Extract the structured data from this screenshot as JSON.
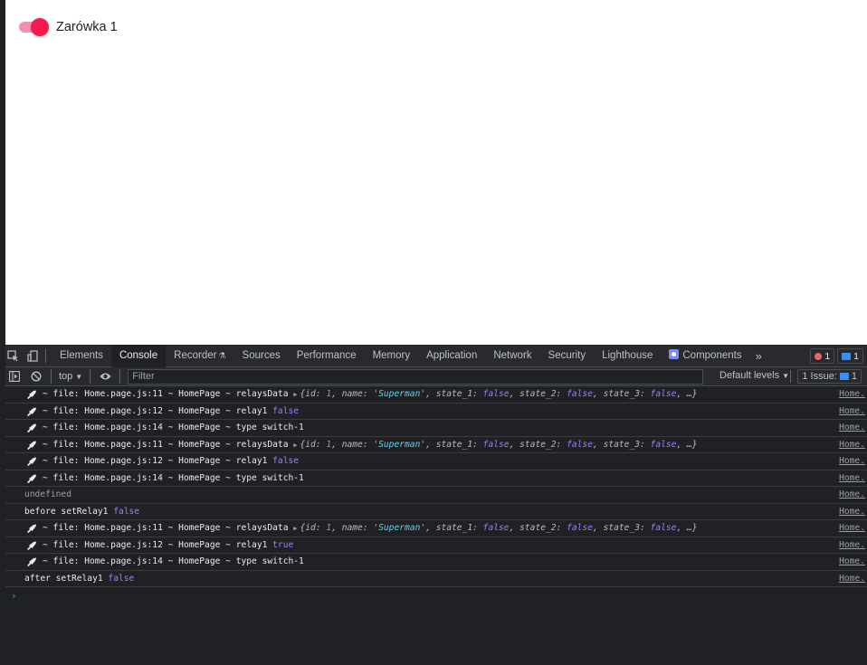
{
  "page": {
    "toggle_label": "Zarówka 1",
    "toggle_on": true
  },
  "devtools": {
    "tabs": [
      {
        "label": "Elements"
      },
      {
        "label": "Console",
        "active": true
      },
      {
        "label": "Recorder",
        "icon": "flask-icon"
      },
      {
        "label": "Sources"
      },
      {
        "label": "Performance"
      },
      {
        "label": "Memory"
      },
      {
        "label": "Application"
      },
      {
        "label": "Network"
      },
      {
        "label": "Security"
      },
      {
        "label": "Lighthouse"
      },
      {
        "label": "Components",
        "icon": "react-components-icon"
      }
    ],
    "more_tabs": "»",
    "error_count": "1",
    "message_count": "1",
    "toolbar": {
      "context": "top",
      "filter_placeholder": "Filter",
      "levels": "Default levels",
      "issues_label": "1 Issue:",
      "issues_count": "1"
    },
    "logs": [
      {
        "rocket": true,
        "prefix": "~ file: Home.page.js:11 ~ HomePage ~ relaysData",
        "object": true,
        "src": "Home."
      },
      {
        "rocket": true,
        "prefix": "~ file: Home.page.js:12 ~ HomePage ~ relay1",
        "value": "false",
        "src": "Home."
      },
      {
        "rocket": true,
        "prefix": "~ file: Home.page.js:14 ~ HomePage ~ type switch-1",
        "src": "Home."
      },
      {
        "rocket": true,
        "prefix": "~ file: Home.page.js:11 ~ HomePage ~ relaysData",
        "object": true,
        "src": "Home."
      },
      {
        "rocket": true,
        "prefix": "~ file: Home.page.js:12 ~ HomePage ~ relay1",
        "value": "false",
        "src": "Home."
      },
      {
        "rocket": true,
        "prefix": "~ file: Home.page.js:14 ~ HomePage ~ type switch-1",
        "src": "Home."
      },
      {
        "rocket": false,
        "grey": true,
        "prefix": "undefined",
        "src": "Home."
      },
      {
        "rocket": false,
        "prefix": "before setRelay1",
        "value": "false",
        "src": "Home."
      },
      {
        "rocket": true,
        "prefix": "~ file: Home.page.js:11 ~ HomePage ~ relaysData",
        "object": true,
        "src": "Home."
      },
      {
        "rocket": true,
        "prefix": "~ file: Home.page.js:12 ~ HomePage ~ relay1",
        "value": "true",
        "src": "Home."
      },
      {
        "rocket": true,
        "prefix": "~ file: Home.page.js:14 ~ HomePage ~ type switch-1",
        "src": "Home."
      },
      {
        "rocket": false,
        "prefix": "after setRelay1",
        "value": "false",
        "src": "Home."
      }
    ],
    "object_preview": {
      "open": "{",
      "entries": [
        {
          "key": "id: ",
          "val": "1",
          "cls": "n"
        },
        {
          "key": "name: ",
          "val": "'Superman'",
          "cls": "s"
        },
        {
          "key": "state_1: ",
          "val": "false",
          "cls": "b"
        },
        {
          "key": "state_2: ",
          "val": "false",
          "cls": "b"
        },
        {
          "key": "state_3: ",
          "val": "false",
          "cls": "b"
        }
      ],
      "close": "…}"
    },
    "prompt": "›"
  }
}
